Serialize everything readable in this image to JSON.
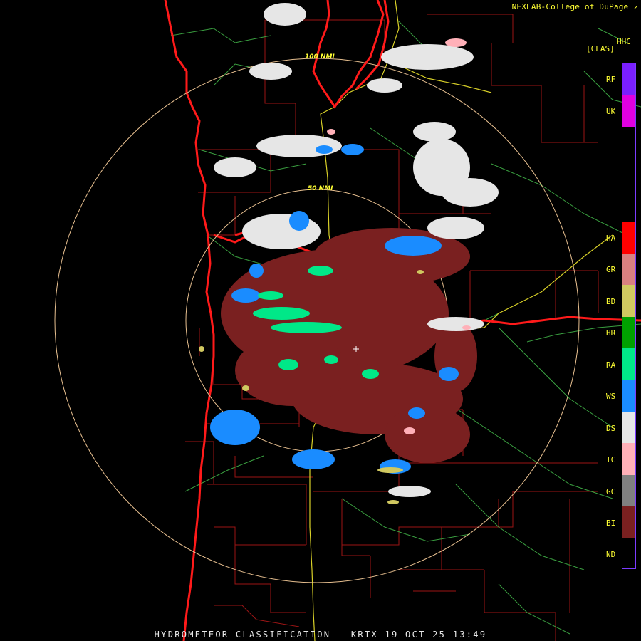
{
  "credit": "NEXLAB-College of DuPage",
  "credit_icon": "external-link-icon",
  "product_code": "HHC",
  "product_tag": "[CLAS]",
  "footer": "HYDROMETEOR CLASSIFICATION - KRTX 19 OCT 25 13:49",
  "range_rings": [
    {
      "label": "100 NMI"
    },
    {
      "label": "50 NMI"
    }
  ],
  "legend": [
    {
      "code": "RF",
      "color": "#7a1fff"
    },
    {
      "code": "UK",
      "color": "#e000e0"
    },
    {
      "code": "HA",
      "color": "#ff0000"
    },
    {
      "code": "GR",
      "color": "#d98080"
    },
    {
      "code": "BD",
      "color": "#d0c860"
    },
    {
      "code": "HR",
      "color": "#00a000"
    },
    {
      "code": "RA",
      "color": "#00e888"
    },
    {
      "code": "WS",
      "color": "#1a8cff"
    },
    {
      "code": "DS",
      "color": "#e6e6e6"
    },
    {
      "code": "IC",
      "color": "#ffb0b8"
    },
    {
      "code": "GC",
      "color": "#808080"
    },
    {
      "code": "BI",
      "color": "#7a2020"
    },
    {
      "code": "ND",
      "color": "#000000"
    }
  ]
}
